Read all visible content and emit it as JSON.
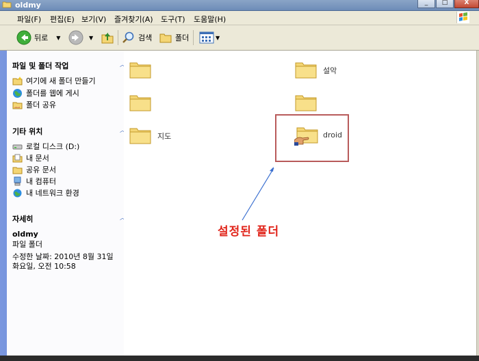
{
  "window": {
    "title": "oldmy"
  },
  "title_buttons": {
    "minimize": "_",
    "maximize": "□",
    "close": "X"
  },
  "menu": [
    "파일(F)",
    "편집(E)",
    "보기(V)",
    "즐겨찾기(A)",
    "도구(T)",
    "도움말(H)"
  ],
  "toolbar": {
    "back": "뒤로",
    "search": "검색",
    "folders": "폴더"
  },
  "left_panel": {
    "tasks": {
      "title": "파일 및 폴더 작업",
      "items": [
        "여기에 새 폴더 만들기",
        "폴더를 웹에 게시",
        "폴더 공유"
      ]
    },
    "other_places": {
      "title": "기타 위치",
      "items": [
        "로컬 디스크 (D:)",
        "내 문서",
        "공유 문서",
        "내 컴퓨터",
        "내 네트워크 환경"
      ]
    },
    "details": {
      "title": "자세히",
      "name": "oldmy",
      "type": "파일 폴더",
      "modified_line1": "수정한 날짜: 2010년 8월 31일",
      "modified_line2": "화요일, 오전 10:58"
    }
  },
  "folders": {
    "f1": "",
    "f2": "설악",
    "f3": "",
    "f4": "",
    "f5": "지도",
    "f6": "droid"
  },
  "annotation": "설정된 폴더",
  "colors": {
    "annotation": "#e1251b",
    "callout_border": "#b85a5a",
    "arrow": "#3a6fd0",
    "panel_gradient": "#7a96df"
  },
  "icons": [
    "folder-icon",
    "back-arrow-icon",
    "forward-arrow-icon",
    "up-folder-icon",
    "search-icon",
    "folders-icon",
    "views-icon",
    "windows-logo-icon",
    "share-hand-icon"
  ]
}
